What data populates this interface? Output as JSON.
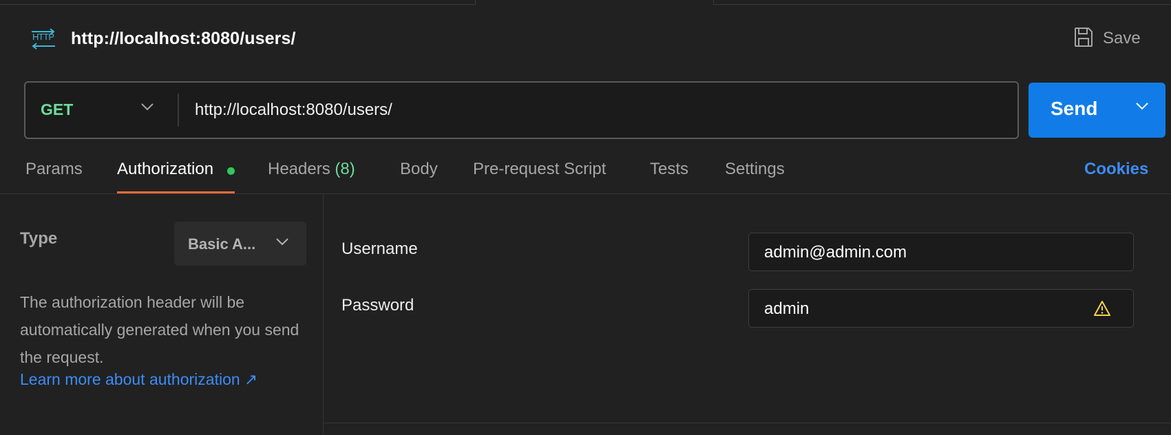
{
  "request": {
    "title": "http://localhost:8080/users/",
    "save_label": "Save"
  },
  "url_bar": {
    "method": "GET",
    "url": "http://localhost:8080/users/",
    "send_label": "Send"
  },
  "tabs": {
    "params": "Params",
    "authorization": "Authorization",
    "headers": "Headers",
    "headers_count": "(8)",
    "body": "Body",
    "prerequest": "Pre-request Script",
    "tests": "Tests",
    "settings": "Settings",
    "cookies": "Cookies",
    "active": "Authorization"
  },
  "auth": {
    "type_label": "Type",
    "type_value": "Basic A...",
    "description": "The authorization header will be automatically generated when you send the request.",
    "learn_more": "Learn more about authorization ↗",
    "username_label": "Username",
    "username_value": "admin@admin.com",
    "password_label": "Password",
    "password_value": "admin"
  },
  "colors": {
    "background": "#212121",
    "accent_blue": "#117ce8",
    "link_blue": "#3c8cf5",
    "method_green": "#6bdd9a",
    "active_tab_underline": "#f26b3a",
    "status_dot": "#30c759",
    "warning_yellow": "#f5d547"
  },
  "icons": {
    "request_type": "http-icon",
    "save": "floppy-disk-icon",
    "dropdown": "chevron-down-icon",
    "password_warning": "warning-triangle-icon"
  }
}
